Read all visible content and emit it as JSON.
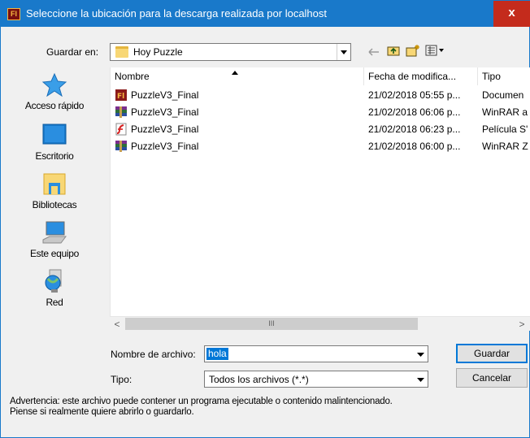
{
  "window": {
    "title": "Seleccione la ubicación para la descarga realizada por localhost",
    "app_icon_label": "Fl",
    "close_label": "x"
  },
  "toolbar": {
    "save_in_label": "Guardar en:",
    "current_folder": "Hoy Puzzle",
    "icons": [
      "back-arrow-icon",
      "up-folder-icon",
      "new-folder-icon",
      "view-menu-icon"
    ]
  },
  "places": [
    {
      "label": "Acceso rápido",
      "icon": "star-icon"
    },
    {
      "label": "Escritorio",
      "icon": "desktop-icon"
    },
    {
      "label": "Bibliotecas",
      "icon": "libraries-icon"
    },
    {
      "label": "Este equipo",
      "icon": "computer-icon"
    },
    {
      "label": "Red",
      "icon": "network-icon"
    }
  ],
  "file_list": {
    "columns": [
      "Nombre",
      "Fecha de modifica...",
      "Tipo"
    ],
    "rows": [
      {
        "name": "PuzzleV3_Final",
        "date": "21/02/2018 05:55 p...",
        "type": "Documen",
        "icon": "flash-document-icon"
      },
      {
        "name": "PuzzleV3_Final",
        "date": "21/02/2018 06:06 p...",
        "type": "WinRAR a",
        "icon": "winrar-icon"
      },
      {
        "name": "PuzzleV3_Final",
        "date": "21/02/2018 06:23 p...",
        "type": "Película S'",
        "icon": "flash-movie-icon"
      },
      {
        "name": "PuzzleV3_Final",
        "date": "21/02/2018 06:00 p...",
        "type": "WinRAR Z",
        "icon": "winrar-icon"
      }
    ],
    "scroll_thumb_label": "III"
  },
  "form": {
    "filename_label": "Nombre de archivo:",
    "filename_value": "hola",
    "type_label": "Tipo:",
    "type_value": "Todos los archivos (*.*)"
  },
  "buttons": {
    "save": "Guardar",
    "cancel": "Cancelar"
  },
  "warning": {
    "line1": "Advertencia: este archivo puede contener un programa ejecutable o contenido malintencionado.",
    "line2": "Piense si realmente quiere abrirlo o guardarlo."
  },
  "colors": {
    "titlebar": "#1979ca",
    "selection": "#0078d7",
    "close": "#c42b1c"
  }
}
